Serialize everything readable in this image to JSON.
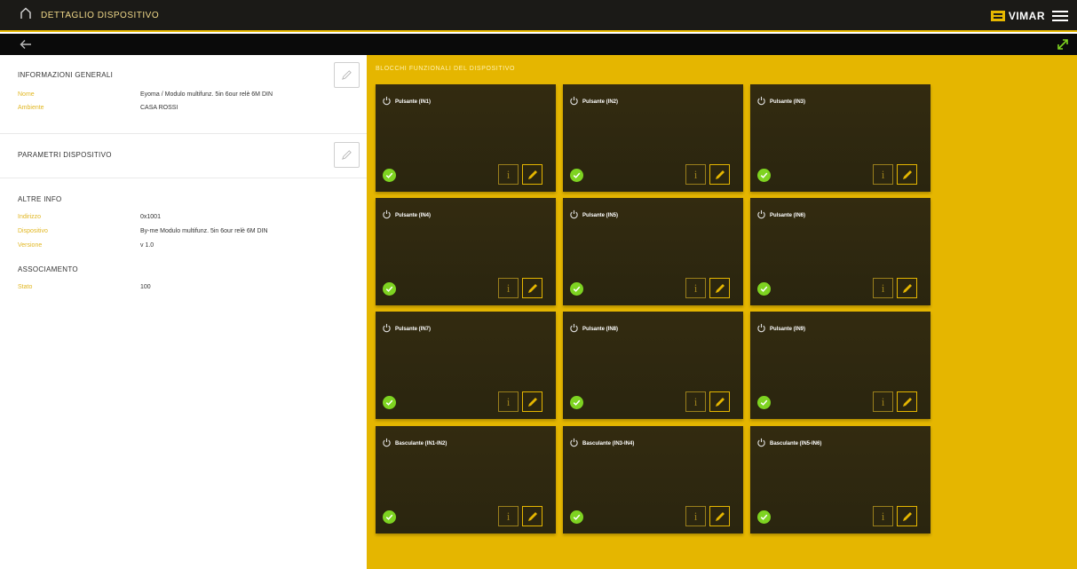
{
  "header": {
    "title": "DETTAGLIO DISPOSITIVO",
    "brand": "VIMAR",
    "icons": {
      "home": "home-icon",
      "menu": "hamburger-menu-icon",
      "back": "back-arrow-icon",
      "expand": "expand-arrows-icon"
    }
  },
  "left": {
    "general": {
      "title": "INFORMAZIONI GENERALI",
      "rows": [
        {
          "label": "Nome",
          "value": "Eyoma / Modulo multifunz. 5in 6our relè 6M DIN"
        },
        {
          "label": "Ambiente",
          "value": "CASA ROSSI"
        }
      ]
    },
    "params": {
      "title": "PARAMETRI DISPOSITIVO"
    },
    "other": {
      "title": "ALTRE INFO",
      "rows": [
        {
          "label": "Indirizzo",
          "value": "0x1001"
        },
        {
          "label": "Dispositivo",
          "value": "By-me Modulo multifunz. 5in 6our relè 6M DIN"
        },
        {
          "label": "Versione",
          "value": "v 1.0"
        }
      ]
    },
    "signal": {
      "title": "ASSOCIAMENTO",
      "rows": [
        {
          "label": "Stato",
          "value": "100"
        }
      ]
    }
  },
  "right": {
    "title": "BLOCCHI FUNZIONALI DEL DISPOSITIVO",
    "tiles": [
      {
        "name": "Pulsante (IN1)",
        "status": "ok"
      },
      {
        "name": "Pulsante (IN2)",
        "status": "ok"
      },
      {
        "name": "Pulsante (IN3)",
        "status": "ok"
      },
      {
        "name": "Pulsante (IN4)",
        "status": "ok"
      },
      {
        "name": "Pulsante (IN5)",
        "status": "ok"
      },
      {
        "name": "Pulsante (IN6)",
        "status": "ok"
      },
      {
        "name": "Pulsante (IN7)",
        "status": "ok"
      },
      {
        "name": "Pulsante (IN8)",
        "status": "ok"
      },
      {
        "name": "Pulsante (IN9)",
        "status": "ok"
      },
      {
        "name": "Basculante (IN1-IN2)",
        "status": "ok"
      },
      {
        "name": "Basculante (IN3-IN4)",
        "status": "ok"
      },
      {
        "name": "Basculante (IN5-IN6)",
        "status": "ok"
      }
    ],
    "colors": {
      "accent": "#e5b600",
      "tile": "#2f2810",
      "ok": "#7ed321"
    }
  }
}
